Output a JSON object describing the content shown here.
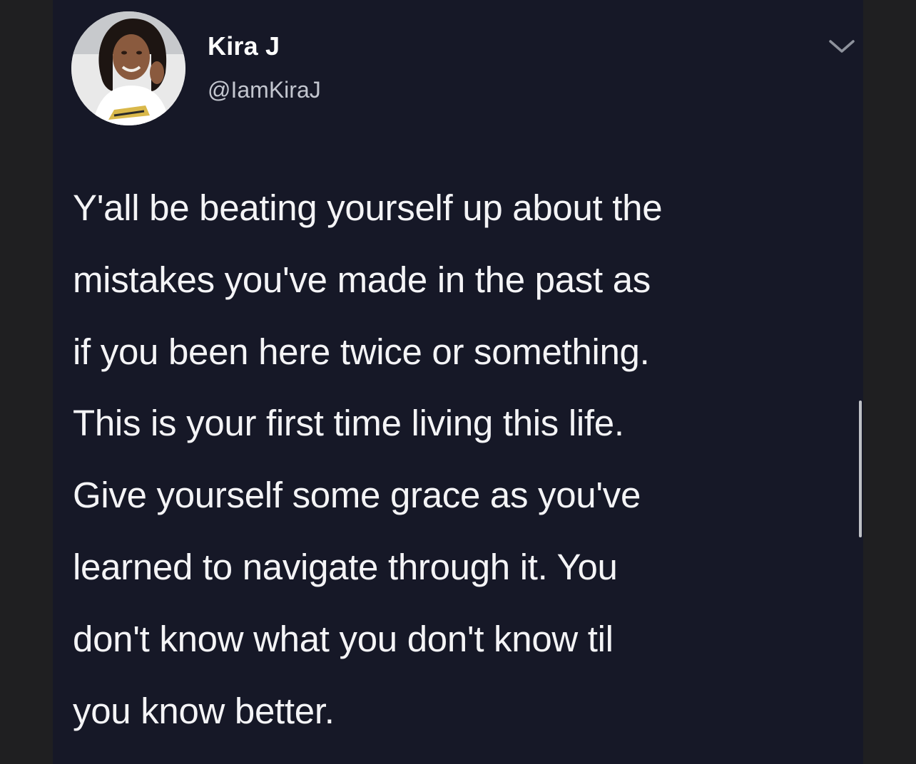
{
  "tweet": {
    "display_name": "Kira J",
    "handle": "@IamKiraJ",
    "text": "Y'all be beating yourself up about the\nmistakes you've made in the past as\nif you been here twice or something.\nThis is your first time living this life.\nGive yourself some grace as you've\nlearned to navigate through it. You\ndon't know what you don't know til\nyou know better."
  },
  "icons": {
    "caret": "chevron-down-icon",
    "avatar": "profile-photo"
  },
  "colors": {
    "background": "#161827",
    "text": "#f4f4f6",
    "handle": "#c3c6cf"
  }
}
